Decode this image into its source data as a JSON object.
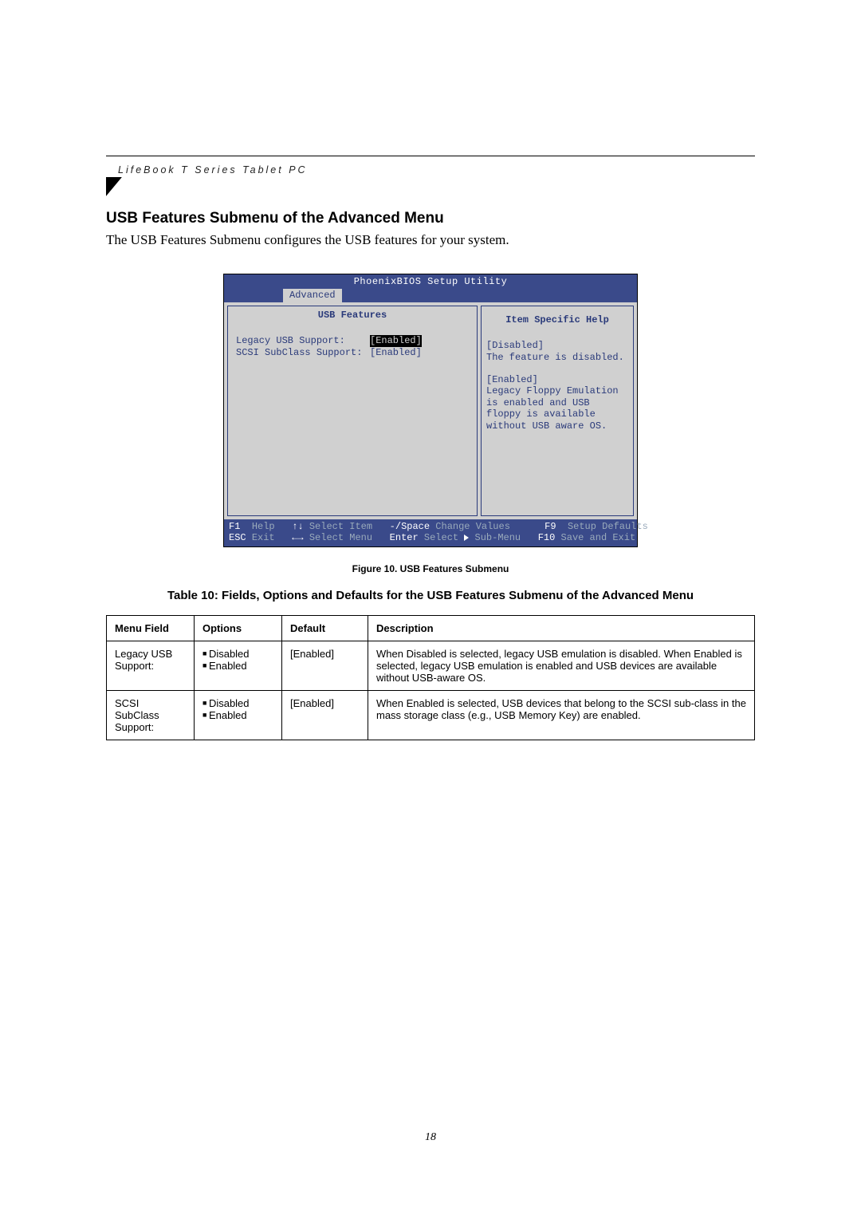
{
  "header": {
    "running_head": "LifeBook T Series Tablet PC"
  },
  "section": {
    "title": "USB Features Submenu of the Advanced Menu",
    "intro": "The USB Features Submenu configures the USB features for your system."
  },
  "bios": {
    "utility_title": "PhoenixBIOS Setup Utility",
    "active_tab": "Advanced",
    "left_panel_title": "USB Features",
    "right_panel_title": "Item Specific Help",
    "settings": [
      {
        "label": "Legacy USB Support:",
        "value": "[Enabled]",
        "selected": true
      },
      {
        "label": "SCSI SubClass Support:",
        "value": "[Enabled]",
        "selected": false
      }
    ],
    "help": {
      "disabled_label": "[Disabled]",
      "disabled_text": "The feature is disabled.",
      "enabled_label": "[Enabled]",
      "enabled_text": "Legacy Floppy Emulation is enabled and USB floppy is available without USB aware OS."
    },
    "footer": {
      "f1": "F1",
      "help": "Help",
      "updn_sym": "↑↓",
      "select_item": "Select Item",
      "minus_space": "-/Space",
      "change_values": "Change Values",
      "f9": "F9",
      "setup_defaults": "Setup Defaults",
      "esc": "ESC",
      "exit": "Exit",
      "lr_sym": "←→",
      "select_menu": "Select Menu",
      "enter": "Enter",
      "select_submenu": "Select ▶ Sub-Menu",
      "f10": "F10",
      "save_exit": "Save and Exit"
    }
  },
  "figure_caption": "Figure 10.   USB Features Submenu",
  "table_caption": "Table 10: Fields, Options and Defaults for the USB Features Submenu of the Advanced Menu",
  "table": {
    "headers": [
      "Menu Field",
      "Options",
      "Default",
      "Description"
    ],
    "rows": [
      {
        "field": "Legacy USB Support:",
        "options": [
          "Disabled",
          "Enabled"
        ],
        "default": "[Enabled]",
        "description": "When Disabled is selected, legacy USB emulation is disabled. When Enabled is selected, legacy USB emulation is enabled and USB devices are available without USB-aware OS."
      },
      {
        "field": "SCSI SubClass Support:",
        "options": [
          "Disabled",
          "Enabled"
        ],
        "default": "[Enabled]",
        "description": "When Enabled is selected, USB devices that belong to the SCSI sub-class in the mass storage class (e.g., USB Memory Key) are enabled."
      }
    ]
  },
  "page_number": "18"
}
